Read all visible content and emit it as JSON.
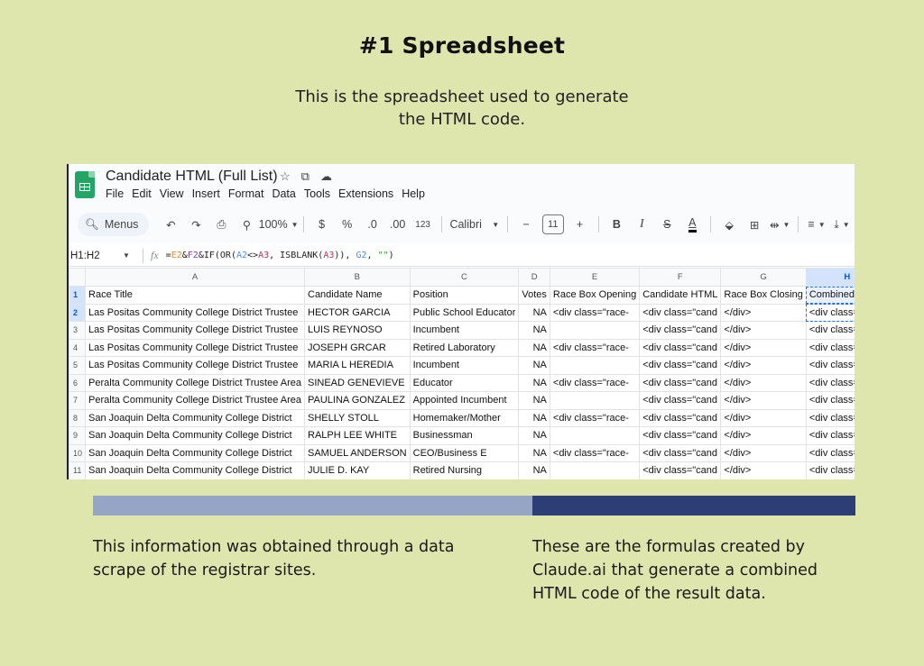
{
  "slide": {
    "title": "#1 Spreadsheet",
    "subtitle_line1": "This is the spreadsheet used to generate",
    "subtitle_line2": "the HTML code.",
    "note_left": "This information was obtained through a data scrape of the registrar sites.",
    "note_right": "These are the formulas created by Claude.ai that generate a combined HTML code of the result data.",
    "colors": {
      "background": "#dfe6ad",
      "bar_left": "#96a5c5",
      "bar_right": "#2d3e76"
    }
  },
  "app": {
    "doc_title": "Candidate HTML (Full List)",
    "title_icons": [
      "star-icon",
      "move-to-folder-icon",
      "cloud-status-icon"
    ],
    "menu": [
      "File",
      "Edit",
      "View",
      "Insert",
      "Format",
      "Data",
      "Tools",
      "Extensions",
      "Help"
    ],
    "toolbar": {
      "search_label": "Menus",
      "zoom": "100%",
      "currency": "$",
      "percent": "%",
      "decrease_decimal": ".0",
      "increase_decimal": ".00",
      "number_format": "123",
      "font": "Calibri",
      "font_size": "11",
      "bold": "B",
      "italic": "I",
      "strikethrough": "S",
      "text_color": "A"
    },
    "formula_bar": {
      "name_box": "H1:H2",
      "fx": "fx",
      "formula_parts": [
        {
          "t": "=",
          "c": ""
        },
        {
          "t": "E2",
          "c": "f-orange"
        },
        {
          "t": "&",
          "c": ""
        },
        {
          "t": "F2",
          "c": "f-purple"
        },
        {
          "t": "&IF(OR(",
          "c": ""
        },
        {
          "t": "A2",
          "c": "f-blue"
        },
        {
          "t": "<>",
          "c": ""
        },
        {
          "t": "A3",
          "c": "f-magenta"
        },
        {
          "t": ", ISBLANK(",
          "c": ""
        },
        {
          "t": "A3",
          "c": "f-magenta"
        },
        {
          "t": ")), ",
          "c": ""
        },
        {
          "t": "G2",
          "c": "f-blue"
        },
        {
          "t": ", ",
          "c": ""
        },
        {
          "t": "\"\"",
          "c": "f-green"
        },
        {
          "t": ")",
          "c": ""
        }
      ]
    },
    "grid": {
      "columns": [
        "A",
        "B",
        "C",
        "D",
        "E",
        "F",
        "G",
        "H"
      ],
      "selected_column": "H",
      "header_row": {
        "row": "1",
        "cells": [
          "Race Title",
          "Candidate Name",
          "Position",
          "Votes",
          "Race Box Opening",
          "Candidate HTML",
          "Race Box Closing",
          "Combined HTML"
        ]
      },
      "rows": [
        {
          "row": "2",
          "cells": [
            "Las Positas Community College District Trustee",
            "HECTOR GARCIA",
            "Public School Educator",
            "NA",
            "<div class=\"race-",
            "<div class=\"cand",
            "</div>",
            "<div class=\"race-"
          ]
        },
        {
          "row": "3",
          "cells": [
            "Las Positas Community College District Trustee",
            "LUIS REYNOSO",
            "Incumbent",
            "NA",
            "",
            "<div class=\"cand",
            "</div>",
            "<div class=\"cand"
          ]
        },
        {
          "row": "4",
          "cells": [
            "Las Positas Community College District Trustee",
            "JOSEPH GRCAR",
            "Retired Laboratory",
            "NA",
            "<div class=\"race-",
            "<div class=\"cand",
            "</div>",
            "<div class=\"race-"
          ]
        },
        {
          "row": "5",
          "cells": [
            "Las Positas Community College District Trustee",
            "MARIA L HEREDIA",
            "Incumbent",
            "NA",
            "",
            "<div class=\"cand",
            "</div>",
            "<div class=\"cand"
          ]
        },
        {
          "row": "6",
          "cells": [
            "Peralta Community College District Trustee Area",
            "SINEAD GENEVIEVE",
            "Educator",
            "NA",
            "<div class=\"race-",
            "<div class=\"cand",
            "</div>",
            "<div class=\"race-"
          ]
        },
        {
          "row": "7",
          "cells": [
            "Peralta Community College District Trustee Area",
            "PAULINA GONZALEZ",
            "Appointed Incumbent",
            "NA",
            "",
            "<div class=\"cand",
            "</div>",
            "<div class=\"cand"
          ]
        },
        {
          "row": "8",
          "cells": [
            "San Joaquin Delta Community College District",
            "SHELLY STOLL",
            "Homemaker/Mother",
            "NA",
            "<div class=\"race-",
            "<div class=\"cand",
            "</div>",
            "<div class=\"race-"
          ]
        },
        {
          "row": "9",
          "cells": [
            "San Joaquin Delta Community College District",
            "RALPH LEE WHITE",
            "Businessman",
            "NA",
            "",
            "<div class=\"cand",
            "</div>",
            "<div class=\"cand"
          ]
        },
        {
          "row": "10",
          "cells": [
            "San Joaquin Delta Community College District",
            "SAMUEL ANDERSON",
            "CEO/Business E",
            "NA",
            "<div class=\"race-",
            "<div class=\"cand",
            "</div>",
            "<div class=\"race-"
          ]
        },
        {
          "row": "11",
          "cells": [
            "San Joaquin Delta Community College District",
            "JULIE D. KAY",
            "Retired Nursing",
            "NA",
            "",
            "<div class=\"cand",
            "</div>",
            "<div class=\"cand"
          ]
        }
      ]
    }
  }
}
